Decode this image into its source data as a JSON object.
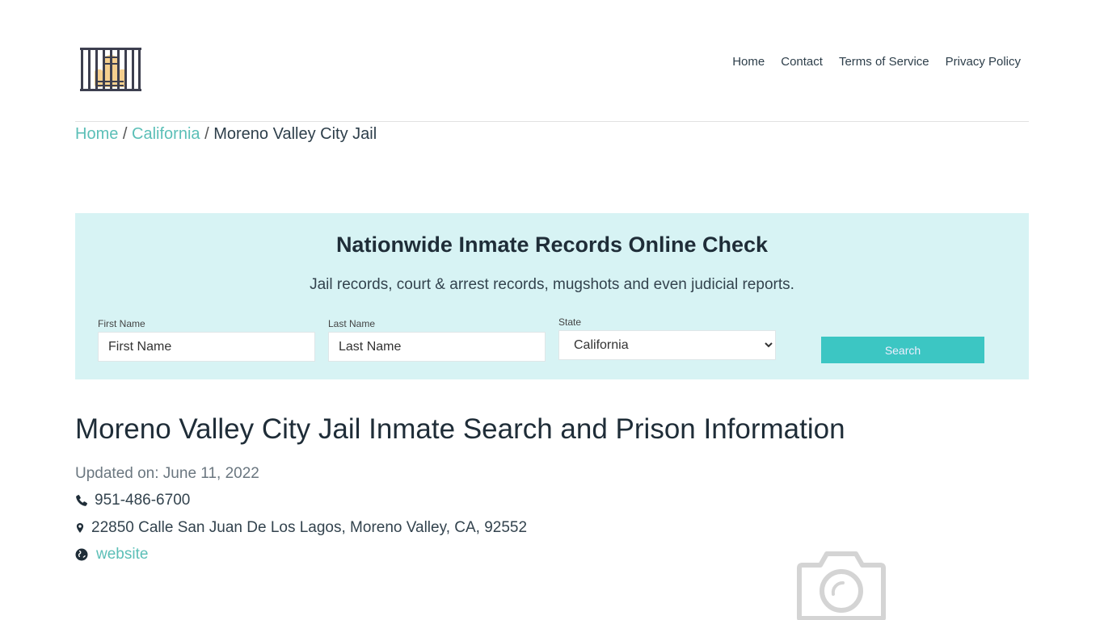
{
  "header": {
    "logo_icon": "jail-bars-icon",
    "nav": [
      {
        "label": "Home"
      },
      {
        "label": "Contact"
      },
      {
        "label": "Terms of Service"
      },
      {
        "label": "Privacy Policy"
      }
    ]
  },
  "breadcrumb": {
    "items": [
      {
        "label": "Home",
        "link": true
      },
      {
        "label": "California",
        "link": true
      },
      {
        "label": "Moreno Valley City Jail",
        "link": false
      }
    ],
    "separator": "/"
  },
  "search_panel": {
    "title": "Nationwide Inmate Records Online Check",
    "subtitle": "Jail records, court & arrest records, mugshots and even judicial reports.",
    "first_name": {
      "label": "First Name",
      "placeholder": "First Name",
      "value": ""
    },
    "last_name": {
      "label": "Last Name",
      "placeholder": "Last Name",
      "value": ""
    },
    "state": {
      "label": "State",
      "selected": "California"
    },
    "search_button": "Search",
    "background_color": "#d7f3f4",
    "button_color": "#3cc6c3"
  },
  "main": {
    "title": "Moreno Valley City Jail Inmate Search and Prison Information",
    "updated": "Updated on: June 11, 2022",
    "phone": "951-486-6700",
    "address": "22850 Calle San Juan De Los Lagos, Moreno Valley, CA, 92552",
    "website_label": "website",
    "image_placeholder_icon": "camera-icon"
  },
  "colors": {
    "accent": "#5bbfb7",
    "text": "#1f2d38"
  }
}
